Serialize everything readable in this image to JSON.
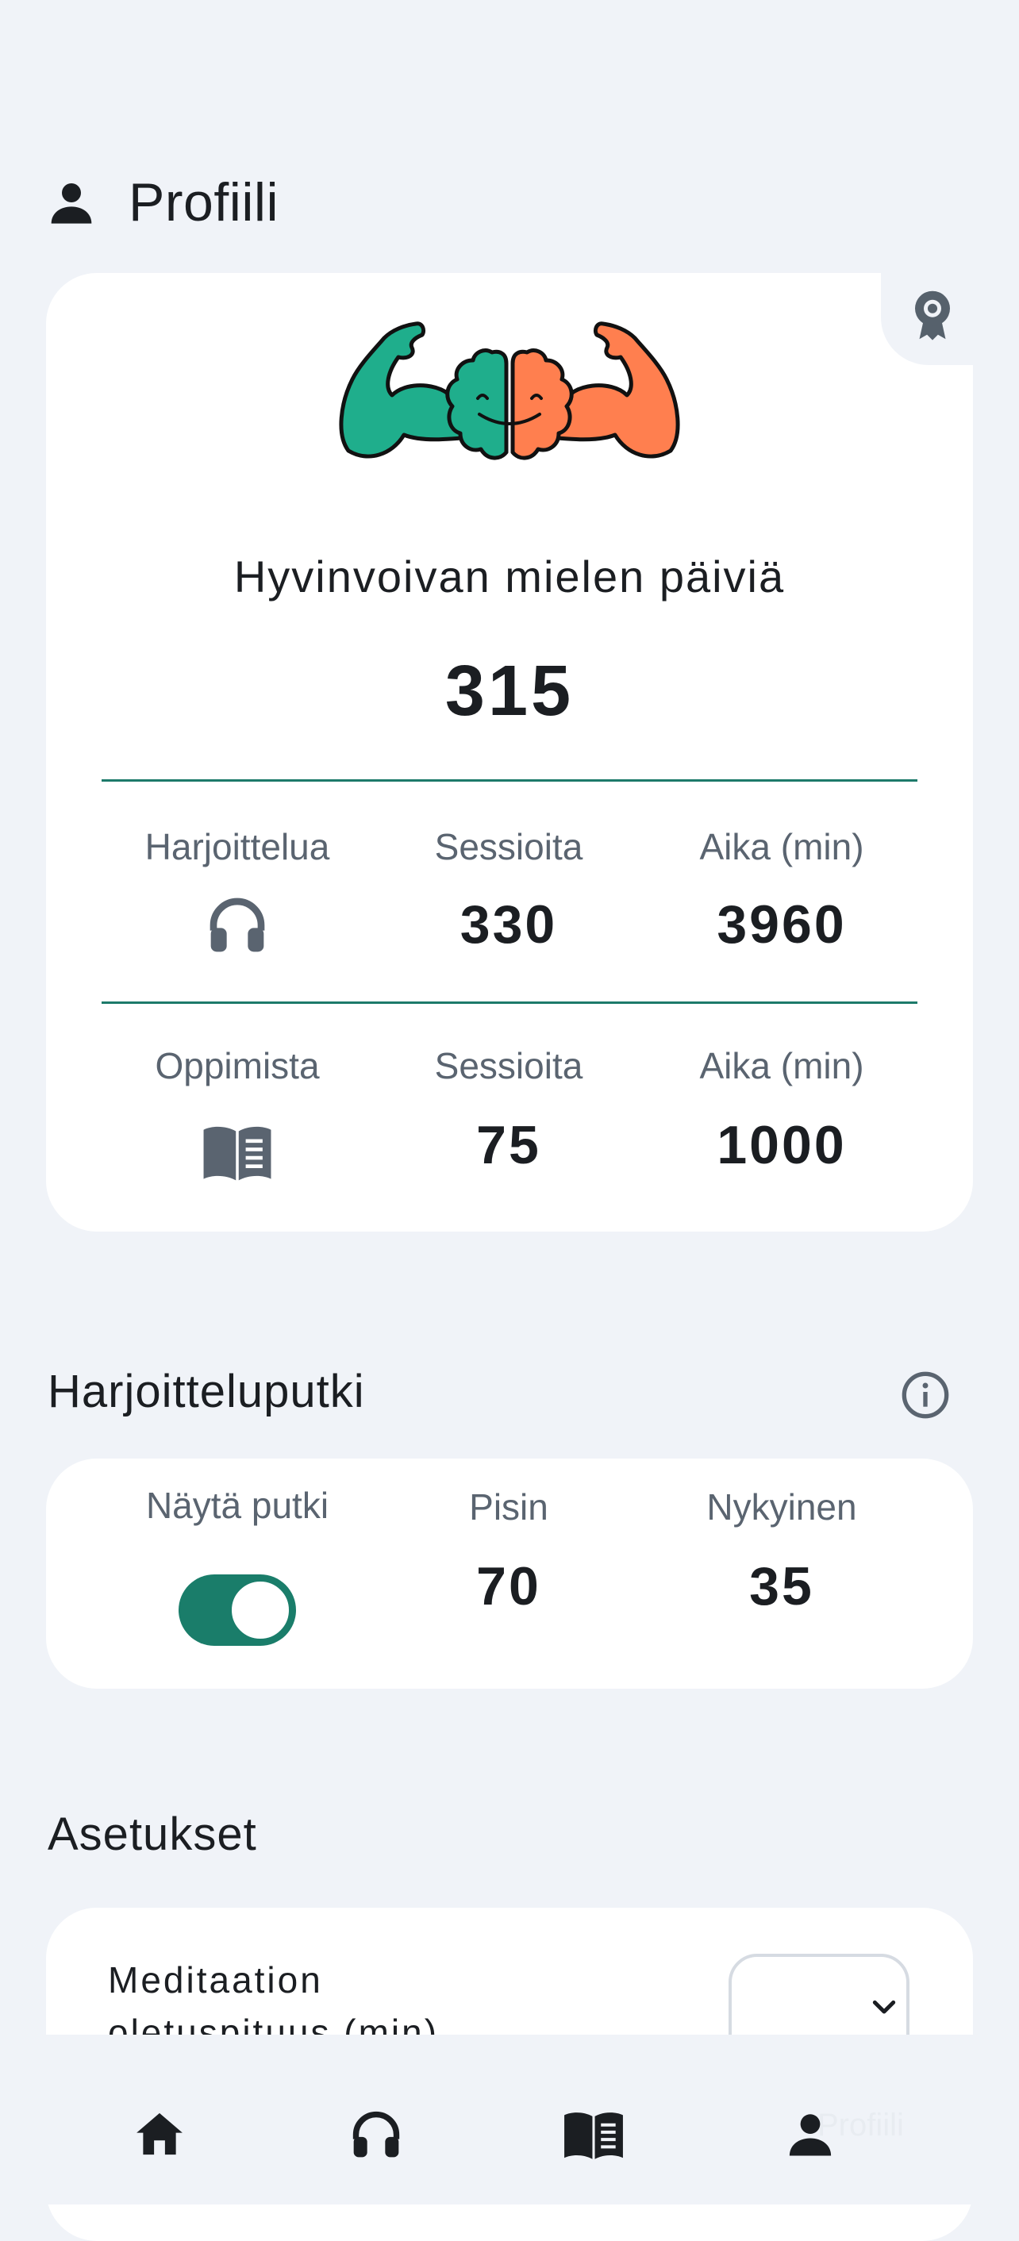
{
  "header": {
    "title": "Profiili",
    "icon": "person-icon"
  },
  "stats": {
    "days_label": "Hyvinvoivan mielen päiviä",
    "days_value": "315",
    "practice": {
      "label": "Harjoittelua",
      "icon": "headphones-icon",
      "sessions_label": "Sessioita",
      "sessions_value": "330",
      "time_label": "Aika (min)",
      "time_value": "3960"
    },
    "learning": {
      "label": "Oppimista",
      "icon": "book-icon",
      "sessions_label": "Sessioita",
      "sessions_value": "75",
      "time_label": "Aika (min)",
      "time_value": "1000"
    }
  },
  "streak": {
    "title": "Harjoitteluputki",
    "show_label": "Näytä putki",
    "show_enabled": true,
    "longest_label": "Pisin",
    "longest_value": "70",
    "current_label": "Nykyinen",
    "current_value": "35"
  },
  "settings": {
    "title": "Asetukset",
    "meditation_length_label_line1": "Meditaation",
    "meditation_length_label_line2": "oletuspituus (min)"
  },
  "nav": {
    "items": [
      "home-icon",
      "headphones-icon",
      "book-icon",
      "person-icon"
    ],
    "active_label": "Profiili"
  },
  "colors": {
    "accent": "#1a7d6a",
    "brain_left": "#1fae8c",
    "brain_right": "#ff7f4f",
    "background": "#f0f3f8"
  }
}
